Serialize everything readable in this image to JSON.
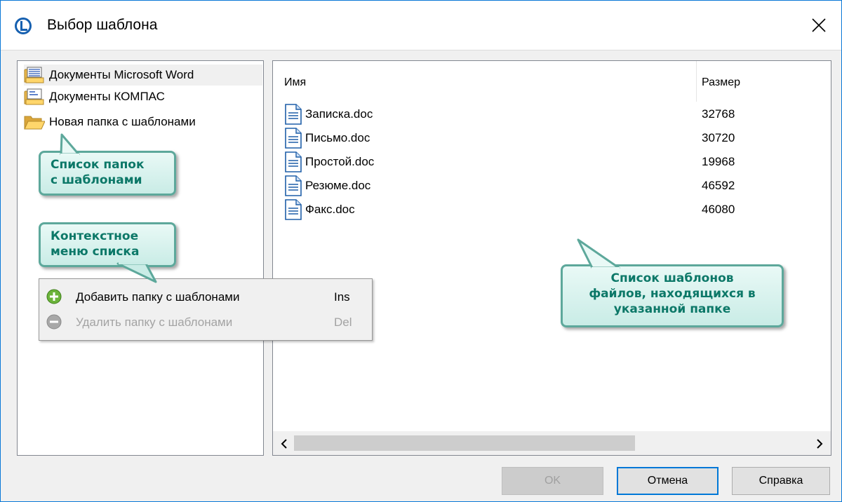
{
  "window": {
    "title": "Выбор шаблона"
  },
  "folders": [
    {
      "label": "Документы Microsoft Word",
      "icon": "word-templates-folder-icon"
    },
    {
      "label": "Документы КОМПАС",
      "icon": "kompas-templates-folder-icon"
    },
    {
      "label": "Новая папка с шаблонами",
      "icon": "open-folder-icon"
    }
  ],
  "files_panel": {
    "col_name": "Имя",
    "col_size": "Размер",
    "rows": [
      {
        "name": "Записка.doc",
        "size": "32768"
      },
      {
        "name": "Письмо.doc",
        "size": "30720"
      },
      {
        "name": "Простой.doc",
        "size": "19968"
      },
      {
        "name": "Резюме.doc",
        "size": "46592"
      },
      {
        "name": "Факс.doc",
        "size": "46080"
      }
    ]
  },
  "context_menu": {
    "items": [
      {
        "label": "Добавить папку с шаблонами",
        "shortcut": "Ins",
        "enabled": true,
        "icon": "add-icon"
      },
      {
        "label": "Удалить папку с шаблонами",
        "shortcut": "Del",
        "enabled": false,
        "icon": "remove-icon"
      }
    ]
  },
  "callouts": {
    "folders_line1": "Список папок",
    "folders_line2": "с шаблонами",
    "menu_line1": "Контекстное",
    "menu_line2": "меню списка",
    "files_line1": "Список шаблонов",
    "files_line2": "файлов, находящихся в",
    "files_line3": "указанной папке"
  },
  "buttons": {
    "ok": "OK",
    "cancel": "Отмена",
    "help": "Справка"
  },
  "colors": {
    "accent": "#0078d7",
    "callout_text": "#0c7868",
    "callout_border": "#5da89b"
  }
}
